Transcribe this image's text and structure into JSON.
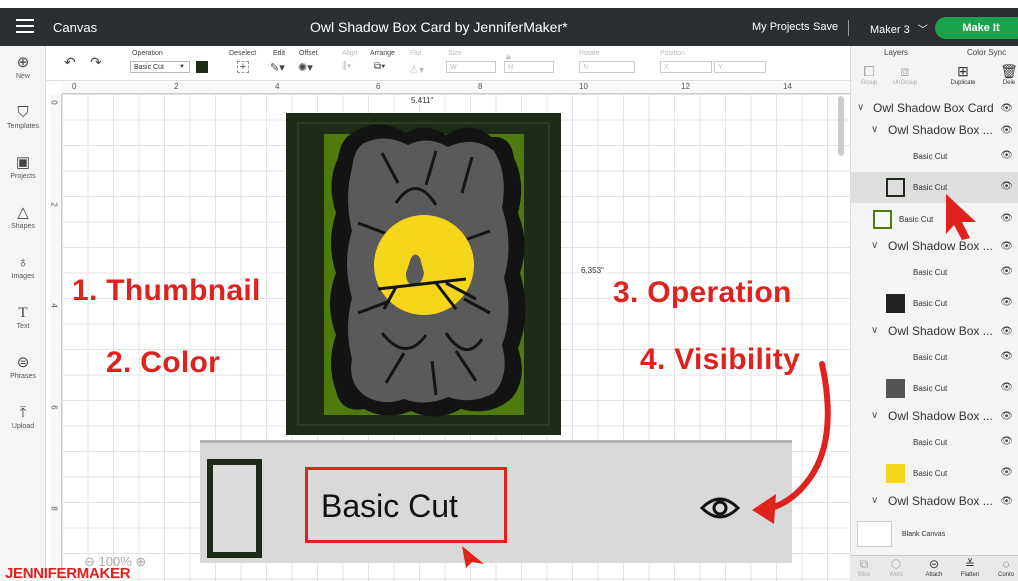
{
  "topbar": {
    "app_name": "Canvas",
    "document_title": "Owl Shadow Box Card by JenniferMaker*",
    "my_projects": "My Projects",
    "save": "Save",
    "machine": "Maker 3",
    "make_it": "Make It"
  },
  "leftbar": [
    {
      "label": "New",
      "icon": "plus-circle-icon"
    },
    {
      "label": "Templates",
      "icon": "shirt-icon"
    },
    {
      "label": "Projects",
      "icon": "clipboard-icon"
    },
    {
      "label": "Shapes",
      "icon": "shapes-icon"
    },
    {
      "label": "Images",
      "icon": "lightbulb-icon"
    },
    {
      "label": "Text",
      "icon": "text-icon"
    },
    {
      "label": "Phrases",
      "icon": "chat-icon"
    },
    {
      "label": "Upload",
      "icon": "upload-icon"
    }
  ],
  "toolbar": {
    "operation_label": "Operation",
    "operation_value": "Basic Cut",
    "deselect": "Deselect",
    "edit": "Edit",
    "offset": "Offset",
    "align": "Align",
    "arrange": "Arrange",
    "flip": "Flip",
    "size": "Size",
    "size_w": "W",
    "size_h": "H",
    "rotate": "Rotate",
    "position": "Position",
    "pos_x": "X",
    "pos_y": "Y",
    "operation_color": "#1e2b16"
  },
  "ruler": {
    "top": [
      "0",
      "2",
      "4",
      "6",
      "8",
      "10",
      "12",
      "14"
    ],
    "left": [
      "0",
      "2",
      "4",
      "6",
      "8"
    ]
  },
  "canvas": {
    "width_dim": "5.411\"",
    "height_dim": "6.353\"",
    "zoom": "100%"
  },
  "annotations": {
    "thumbnail": "1. Thumbnail",
    "color": "2. Color",
    "operation": "3. Operation",
    "visibility": "4. Visibility",
    "accent_color": "#e0221f"
  },
  "zoom_callout": {
    "label": "Basic Cut"
  },
  "logo": {
    "part1": "JENNIFER",
    "part2": "MAKER"
  },
  "right_panel": {
    "tabs": [
      "Layers",
      "Color Sync"
    ],
    "actions": [
      {
        "label": "Group",
        "icon": "group-icon",
        "enabled": false
      },
      {
        "label": "UnGroup",
        "icon": "ungroup-icon",
        "enabled": false
      },
      {
        "label": "Duplicate",
        "icon": "duplicate-icon",
        "enabled": true
      },
      {
        "label": "Dele",
        "icon": "trash-icon",
        "enabled": true
      }
    ],
    "layers": [
      {
        "name": "Owl Shadow Box Card",
        "level": 0,
        "group": true
      },
      {
        "name": "Owl Shadow Box ...",
        "level": 1,
        "group": true
      },
      {
        "name": "Basic Cut",
        "level": 2,
        "thumb": "none"
      },
      {
        "name": "Basic Cut",
        "level": 2,
        "thumb": "frame-dark",
        "selected": true
      },
      {
        "name": "Basic Cut",
        "level": 1,
        "thumb": "frame-green"
      },
      {
        "name": "Owl Shadow Box ...",
        "level": 1,
        "group": true
      },
      {
        "name": "Basic Cut",
        "level": 2,
        "thumb": "none"
      },
      {
        "name": "Basic Cut",
        "level": 2,
        "thumb": "tree-dark"
      },
      {
        "name": "Owl Shadow Box ...",
        "level": 1,
        "group": true
      },
      {
        "name": "Basic Cut",
        "level": 2,
        "thumb": "none"
      },
      {
        "name": "Basic Cut",
        "level": 2,
        "thumb": "tree-gray"
      },
      {
        "name": "Owl Shadow Box ...",
        "level": 1,
        "group": true
      },
      {
        "name": "Basic Cut",
        "level": 2,
        "thumb": "none"
      },
      {
        "name": "Basic Cut",
        "level": 2,
        "thumb": "yellow"
      },
      {
        "name": "Owl Shadow Box ...",
        "level": 1,
        "group": true
      }
    ],
    "blank_canvas": "Blank Canvas",
    "bottom_actions": [
      {
        "label": "Slice",
        "enabled": false
      },
      {
        "label": "Weld",
        "enabled": false
      },
      {
        "label": "Attach",
        "enabled": true
      },
      {
        "label": "Flatten",
        "enabled": true
      },
      {
        "label": "Conto",
        "enabled": true
      }
    ]
  }
}
